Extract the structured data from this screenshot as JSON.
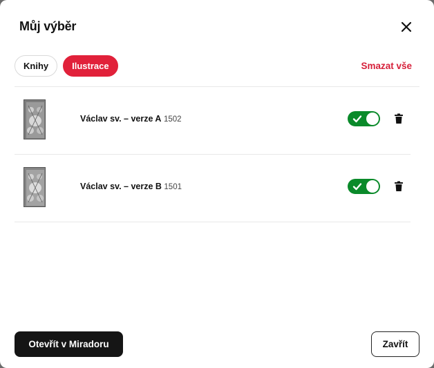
{
  "modal": {
    "title": "Můj výběr",
    "close_icon": "close-icon"
  },
  "tabs": [
    {
      "label": "Knihy",
      "active": false
    },
    {
      "label": "Ilustrace",
      "active": true
    }
  ],
  "clear_all_label": "Smazat vše",
  "items": [
    {
      "name": "Václav sv. – verze A",
      "year": "1502",
      "enabled": true,
      "thumb_icon": "illustration-thumbnail"
    },
    {
      "name": "Václav sv. – verze B",
      "year": "1501",
      "enabled": true,
      "thumb_icon": "illustration-thumbnail"
    }
  ],
  "footer": {
    "open_label": "Otevřít v Miradoru",
    "close_label": "Zavřít"
  },
  "colors": {
    "accent": "#e1213a",
    "toggle_on": "#0a8a2a",
    "primary_button": "#151515"
  }
}
